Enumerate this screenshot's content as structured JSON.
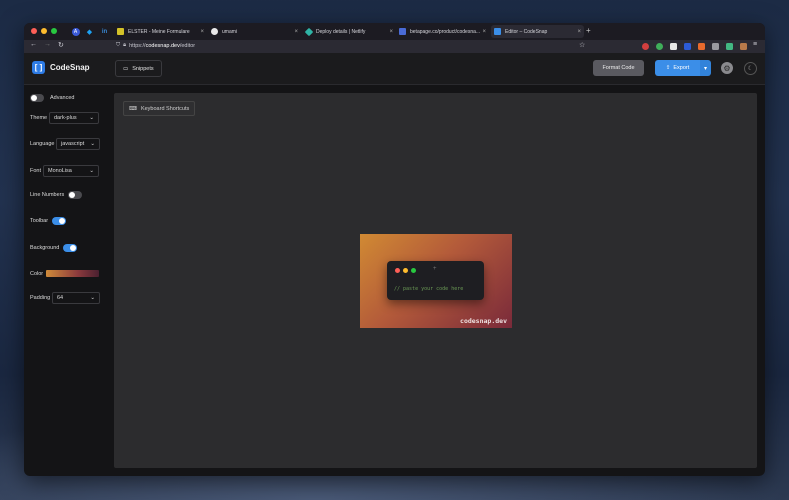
{
  "browser": {
    "tabs": [
      {
        "title": "ELSTER - Meine Formulare",
        "color": "#d4c228"
      },
      {
        "title": "umami",
        "color": "#e8e8e8"
      },
      {
        "title": "Deploy details | Netlify",
        "color": "#2fb4a6"
      },
      {
        "title": "betapage.co/product/codesna...",
        "color": "#4a6bd6"
      },
      {
        "title": "Editor – CodeSnap",
        "color": "#3b8ee8",
        "active": true
      }
    ],
    "url_prefix": "https://",
    "url_host": "codesnap.dev",
    "url_path": "/editor"
  },
  "app": {
    "name": "CodeSnap",
    "snippets_label": "Snippets",
    "format_label": "Format Code",
    "export_label": "Export"
  },
  "settings": {
    "advanced_label": "Advanced",
    "theme_label": "Theme",
    "theme_value": "dark-plus",
    "language_label": "Language",
    "language_value": "javascript",
    "font_label": "Font",
    "font_value": "MonoLisa",
    "line_numbers_label": "Line Numbers",
    "toolbar_label": "Toolbar",
    "background_label": "Background",
    "color_label": "Color",
    "padding_label": "Padding",
    "padding_value": "64",
    "advanced_on": false,
    "line_numbers_on": false,
    "toolbar_on": true,
    "background_on": true
  },
  "editor": {
    "shortcuts_label": "Keyboard Shortcuts",
    "code_placeholder": "// paste your code here",
    "watermark": "codesnap.dev"
  },
  "colors": {
    "accent": "#3b8ee8",
    "gradient_start": "#d18a33",
    "gradient_end": "#7a2a3a"
  }
}
